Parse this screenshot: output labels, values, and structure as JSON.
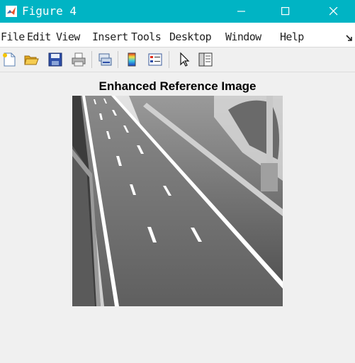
{
  "window": {
    "title": "Figure 4",
    "icon": "matlab-icon",
    "controls": [
      "minimize-icon",
      "maximize-icon",
      "close-icon"
    ]
  },
  "menu": {
    "items": [
      "File",
      "Edit",
      "View",
      "Insert",
      "Tools",
      "Desktop",
      "Window",
      "Help"
    ]
  },
  "toolbar": {
    "tools": [
      "new-figure-icon",
      "open-file-icon",
      "save-icon",
      "print-icon",
      "link-plot-icon",
      "insert-colorbar-icon",
      "insert-legend-icon",
      "edit-plot-icon",
      "property-inspector-icon"
    ]
  },
  "figure": {
    "title": "Enhanced Reference Image",
    "image_description_icon": "grayscale-road-image"
  },
  "colors": {
    "titlebar": "#00b4c4",
    "background": "#f0f0f0"
  }
}
